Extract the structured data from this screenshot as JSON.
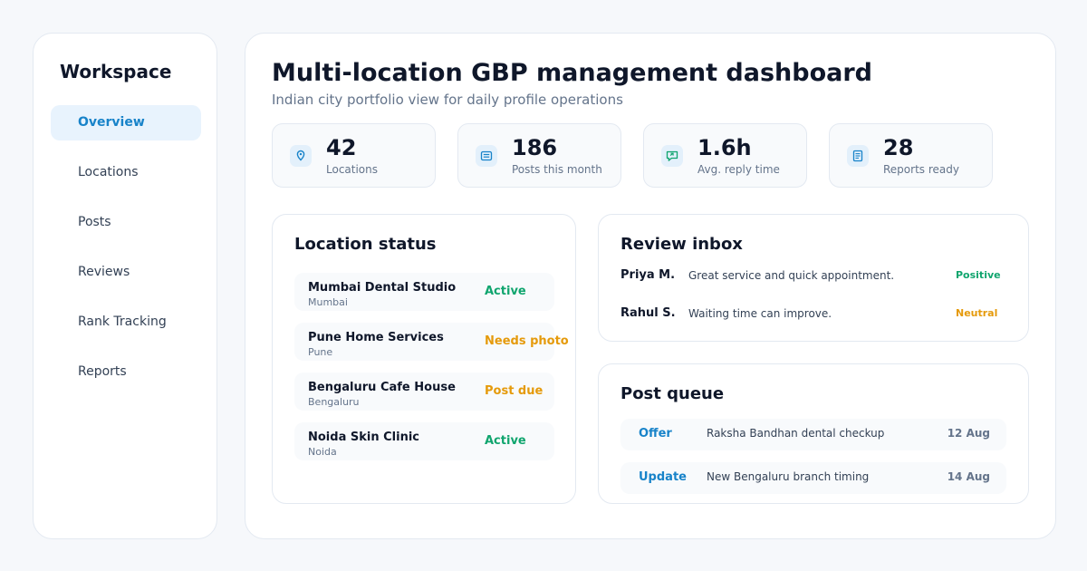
{
  "sidebar": {
    "title": "Workspace",
    "items": [
      {
        "label": "Overview",
        "active": true
      },
      {
        "label": "Locations",
        "active": false
      },
      {
        "label": "Posts",
        "active": false
      },
      {
        "label": "Reviews",
        "active": false
      },
      {
        "label": "Rank Tracking",
        "active": false
      },
      {
        "label": "Reports",
        "active": false
      }
    ]
  },
  "header": {
    "title": "Multi-location GBP management dashboard",
    "subtitle": "Indian city portfolio view for daily profile operations"
  },
  "stats": [
    {
      "icon": "map-pin-icon",
      "value": "42",
      "label": "Locations"
    },
    {
      "icon": "document-icon",
      "value": "186",
      "label": "Posts this month"
    },
    {
      "icon": "chat-reply-icon",
      "value": "1.6h",
      "label": "Avg. reply time"
    },
    {
      "icon": "report-icon",
      "value": "28",
      "label": "Reports ready"
    }
  ],
  "location_status": {
    "title": "Location status",
    "rows": [
      {
        "name": "Mumbai Dental Studio",
        "city": "Mumbai",
        "status": "Active"
      },
      {
        "name": "Pune Home Services",
        "city": "Pune",
        "status": "Needs photo"
      },
      {
        "name": "Bengaluru Cafe House",
        "city": "Bengaluru",
        "status": "Post due"
      },
      {
        "name": "Noida Skin Clinic",
        "city": "Noida",
        "status": "Active"
      }
    ]
  },
  "review_inbox": {
    "title": "Review inbox",
    "rows": [
      {
        "author": "Priya M.",
        "text": "Great service and quick appointment.",
        "sentiment": "Positive"
      },
      {
        "author": "Rahul S.",
        "text": "Waiting time can improve.",
        "sentiment": "Neutral"
      }
    ]
  },
  "post_queue": {
    "title": "Post queue",
    "rows": [
      {
        "type": "Offer",
        "title": "Raksha Bandhan dental checkup",
        "date": "12 Aug"
      },
      {
        "type": "Update",
        "title": "New Bengaluru branch timing",
        "date": "14 Aug"
      }
    ]
  },
  "colors": {
    "accent": "#1883c9",
    "active": "#10a56e",
    "warning": "#e59a0b",
    "neutral": "#e59a0b"
  }
}
